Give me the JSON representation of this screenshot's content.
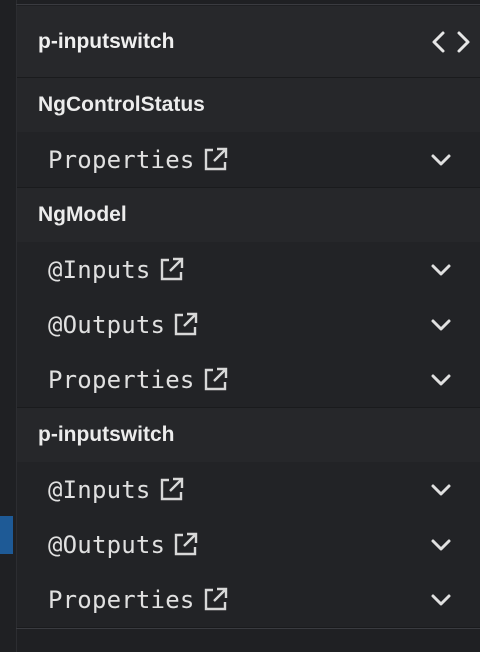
{
  "header": {
    "title": "p-inputswitch",
    "icon": "code-icon"
  },
  "sections": [
    {
      "title": "NgControlStatus",
      "rows": [
        {
          "label": "Properties"
        }
      ]
    },
    {
      "title": "NgModel",
      "rows": [
        {
          "label": "@Inputs"
        },
        {
          "label": "@Outputs"
        },
        {
          "label": "Properties"
        }
      ]
    },
    {
      "title": "p-inputswitch",
      "rows": [
        {
          "label": "@Inputs"
        },
        {
          "label": "@Outputs"
        },
        {
          "label": "Properties"
        }
      ]
    }
  ],
  "icons": {
    "external": "external-link-icon",
    "expand": "chevron-down-icon"
  },
  "colors": {
    "background": "#1f2023",
    "header": "#27282b",
    "row": "#222326",
    "accent": "#1e5a96"
  }
}
